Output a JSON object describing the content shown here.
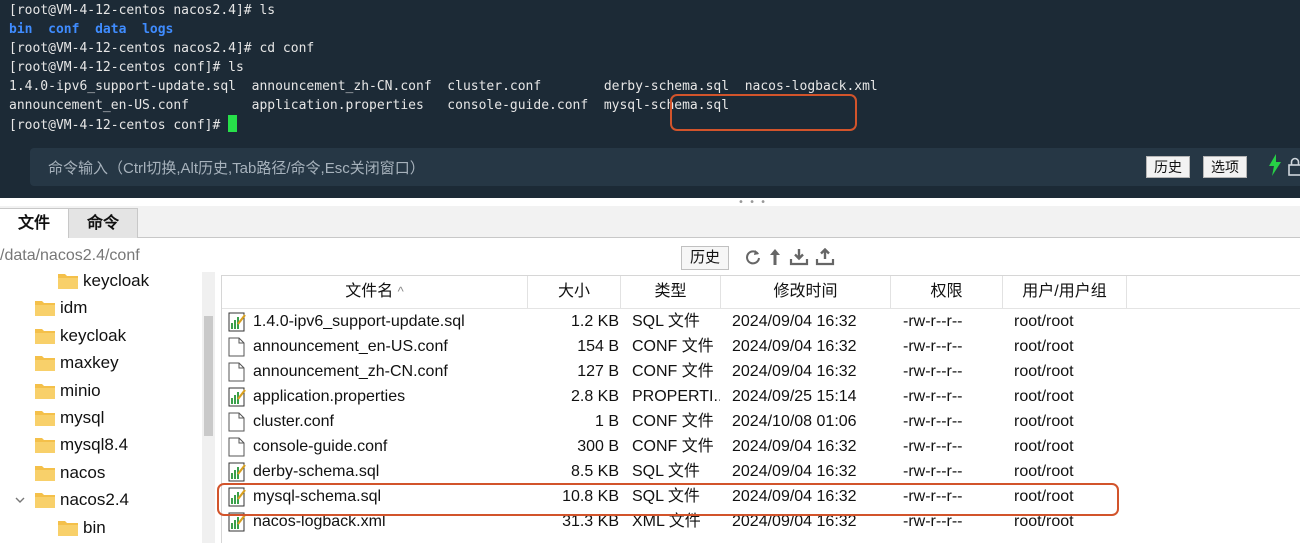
{
  "terminal": {
    "lines": [
      {
        "segments": [
          {
            "text": "[root@VM-4-12-centos nacos2.4]# ls",
            "kind": "plain"
          }
        ]
      },
      {
        "segments": [
          {
            "text": "bin",
            "kind": "dir"
          },
          {
            "text": "  ",
            "kind": "plain"
          },
          {
            "text": "conf",
            "kind": "dir"
          },
          {
            "text": "  ",
            "kind": "plain"
          },
          {
            "text": "data",
            "kind": "dir"
          },
          {
            "text": "  ",
            "kind": "plain"
          },
          {
            "text": "logs",
            "kind": "dir"
          }
        ]
      },
      {
        "segments": [
          {
            "text": "[root@VM-4-12-centos nacos2.4]# cd conf",
            "kind": "plain"
          }
        ]
      },
      {
        "segments": [
          {
            "text": "[root@VM-4-12-centos conf]# ls",
            "kind": "plain"
          }
        ]
      },
      {
        "segments": [
          {
            "text": "1.4.0-ipv6_support-update.sql  announcement_zh-CN.conf  cluster.conf        derby-schema.sql  nacos-logback.xml",
            "kind": "plain"
          }
        ]
      },
      {
        "segments": [
          {
            "text": "announcement_en-US.conf        application.properties   console-guide.conf  mysql-schema.sql",
            "kind": "plain"
          }
        ]
      },
      {
        "segments": [
          {
            "text": "[root@VM-4-12-centos conf]# ",
            "kind": "plain"
          },
          {
            "text": "",
            "kind": "cursor"
          }
        ]
      }
    ],
    "command_placeholder": "命令输入（Ctrl切换,Alt历史,Tab路径/命令,Esc关闭窗口）",
    "history_button": "历史",
    "options_button": "选项"
  },
  "tabs": [
    {
      "label": "文件",
      "active": true
    },
    {
      "label": "命令",
      "active": false
    }
  ],
  "path": "/data/nacos2.4/conf",
  "path_history_button": "历史",
  "tree": [
    {
      "label": "keycloak",
      "indent": 1,
      "chevron": ""
    },
    {
      "label": "idm",
      "indent": 0,
      "chevron": ""
    },
    {
      "label": "keycloak",
      "indent": 0,
      "chevron": ""
    },
    {
      "label": "maxkey",
      "indent": 0,
      "chevron": ""
    },
    {
      "label": "minio",
      "indent": 0,
      "chevron": ""
    },
    {
      "label": "mysql",
      "indent": 0,
      "chevron": ""
    },
    {
      "label": "mysql8.4",
      "indent": 0,
      "chevron": ""
    },
    {
      "label": "nacos",
      "indent": 0,
      "chevron": ""
    },
    {
      "label": "nacos2.4",
      "indent": 0,
      "chevron": "expanded"
    },
    {
      "label": "bin",
      "indent": 1,
      "chevron": ""
    }
  ],
  "file_table": {
    "columns": [
      "文件名",
      "大小",
      "类型",
      "修改时间",
      "权限",
      "用户/用户组"
    ],
    "sort_indicator": "^",
    "rows": [
      {
        "name": "1.4.0-ipv6_support-update.sql",
        "size": "1.2 KB",
        "type": "SQL 文件",
        "modified": "2024/09/04 16:32",
        "perm": "-rw-r--r--",
        "owner": "root/root",
        "icon": "sql"
      },
      {
        "name": "announcement_en-US.conf",
        "size": "154 B",
        "type": "CONF 文件",
        "modified": "2024/09/04 16:32",
        "perm": "-rw-r--r--",
        "owner": "root/root",
        "icon": "doc"
      },
      {
        "name": "announcement_zh-CN.conf",
        "size": "127 B",
        "type": "CONF 文件",
        "modified": "2024/09/04 16:32",
        "perm": "-rw-r--r--",
        "owner": "root/root",
        "icon": "doc"
      },
      {
        "name": "application.properties",
        "size": "2.8 KB",
        "type": "PROPERTI...",
        "modified": "2024/09/25 15:14",
        "perm": "-rw-r--r--",
        "owner": "root/root",
        "icon": "sql"
      },
      {
        "name": "cluster.conf",
        "size": "1 B",
        "type": "CONF 文件",
        "modified": "2024/10/08 01:06",
        "perm": "-rw-r--r--",
        "owner": "root/root",
        "icon": "doc"
      },
      {
        "name": "console-guide.conf",
        "size": "300 B",
        "type": "CONF 文件",
        "modified": "2024/09/04 16:32",
        "perm": "-rw-r--r--",
        "owner": "root/root",
        "icon": "doc"
      },
      {
        "name": "derby-schema.sql",
        "size": "8.5 KB",
        "type": "SQL 文件",
        "modified": "2024/09/04 16:32",
        "perm": "-rw-r--r--",
        "owner": "root/root",
        "icon": "sql"
      },
      {
        "name": "mysql-schema.sql",
        "size": "10.8 KB",
        "type": "SQL 文件",
        "modified": "2024/09/04 16:32",
        "perm": "-rw-r--r--",
        "owner": "root/root",
        "icon": "sql"
      },
      {
        "name": "nacos-logback.xml",
        "size": "31.3 KB",
        "type": "XML 文件",
        "modified": "2024/09/04 16:32",
        "perm": "-rw-r--r--",
        "owner": "root/root",
        "icon": "sql"
      }
    ]
  },
  "colors": {
    "terminal_bg": "#1c2a36",
    "dir_blue": "#3f8cff",
    "cursor_green": "#27e04a",
    "highlight": "#d2542b"
  }
}
